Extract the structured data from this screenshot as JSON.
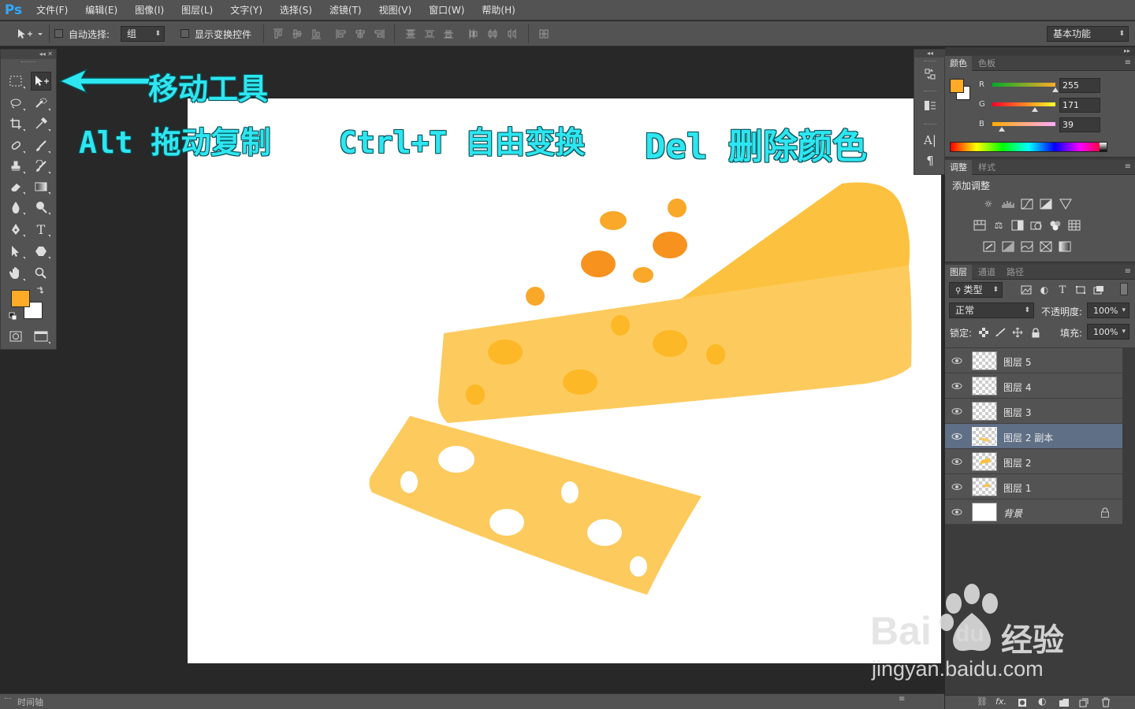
{
  "app": {
    "logo": "Ps"
  },
  "menu": [
    "文件(F)",
    "编辑(E)",
    "图像(I)",
    "图层(L)",
    "文字(Y)",
    "选择(S)",
    "滤镜(T)",
    "视图(V)",
    "窗口(W)",
    "帮助(H)"
  ],
  "options": {
    "auto_select_label": "自动选择:",
    "auto_select_value": "组",
    "show_transform_label": "显示变换控件",
    "workspace_value": "基本功能"
  },
  "annotations": {
    "move_tool": "移动工具",
    "alt_drag": "Alt 拖动复制",
    "ctrl_t": "Ctrl+T 自由变换",
    "del": "Del 删除颜色"
  },
  "colors": {
    "foreground": "#ffab27",
    "background": "#ffffff",
    "accent": "#2de6f0",
    "cheese_top": "#fcc23f",
    "cheese_side": "#fdc95c",
    "cheese_hole": "#f9a82a",
    "cheese_hole_dark": "#f7921f"
  },
  "color_panel": {
    "tabs": [
      "颜色",
      "色板"
    ],
    "r_label": "R",
    "r_value": "255",
    "g_label": "G",
    "g_value": "171",
    "b_label": "B",
    "b_value": "39"
  },
  "adjust_panel": {
    "tabs": [
      "调整",
      "样式"
    ],
    "title": "添加调整"
  },
  "layers_panel": {
    "tabs": [
      "图层",
      "通道",
      "路径"
    ],
    "filter_value": "类型",
    "blend_mode": "正常",
    "opacity_label": "不透明度:",
    "opacity_value": "100%",
    "lock_label": "锁定:",
    "fill_label": "填充:",
    "fill_value": "100%",
    "layers": [
      {
        "name": "图层 5"
      },
      {
        "name": "图层 4"
      },
      {
        "name": "图层 3"
      },
      {
        "name": "图层 2 副本"
      },
      {
        "name": "图层 2"
      },
      {
        "name": "图层 1"
      },
      {
        "name": "背景"
      }
    ]
  },
  "status": {
    "timeline_label": "时间轴"
  },
  "watermark": {
    "brand": "Bai",
    "brand2": "du",
    "brand_cn": "经验",
    "url": "jingyan.baidu.com"
  }
}
